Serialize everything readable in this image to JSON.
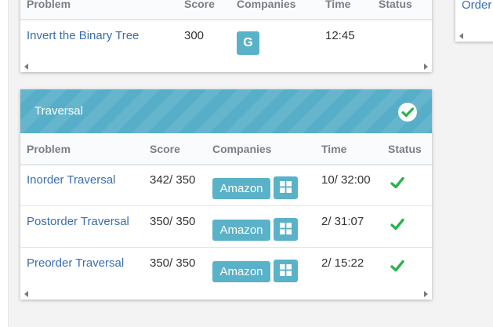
{
  "top_table": {
    "headers": [
      "Problem",
      "Score",
      "Companies",
      "Time",
      "Status"
    ],
    "row": {
      "problem": "Invert the Binary Tree",
      "score": "300",
      "company_icon": "google-g-icon",
      "company_letter": "G",
      "time": "12:45"
    }
  },
  "right_panel": {
    "link_text": "Order"
  },
  "traversal": {
    "title": "Traversal",
    "title_status_icon": "check-circle-icon",
    "headers": [
      "Problem",
      "Score",
      "Companies",
      "Time",
      "Status"
    ],
    "rows": [
      {
        "problem": "Inorder Traversal",
        "score": "342/ 350",
        "company": "Amazon",
        "company_icon": "windows-icon",
        "time": "10/ 32:00",
        "status_icon": "check-icon"
      },
      {
        "problem": "Postorder Traversal",
        "score": "350/ 350",
        "company": "Amazon",
        "company_icon": "windows-icon",
        "time": "2/ 31:07",
        "status_icon": "check-icon"
      },
      {
        "problem": "Preorder Traversal",
        "score": "350/ 350",
        "company": "Amazon",
        "company_icon": "windows-icon",
        "time": "2/ 15:22",
        "status_icon": "check-icon"
      }
    ]
  },
  "colors": {
    "accent": "#56aec8",
    "badge": "#5ab2c9",
    "link": "#3a6eb0",
    "success": "#2bb24c"
  }
}
